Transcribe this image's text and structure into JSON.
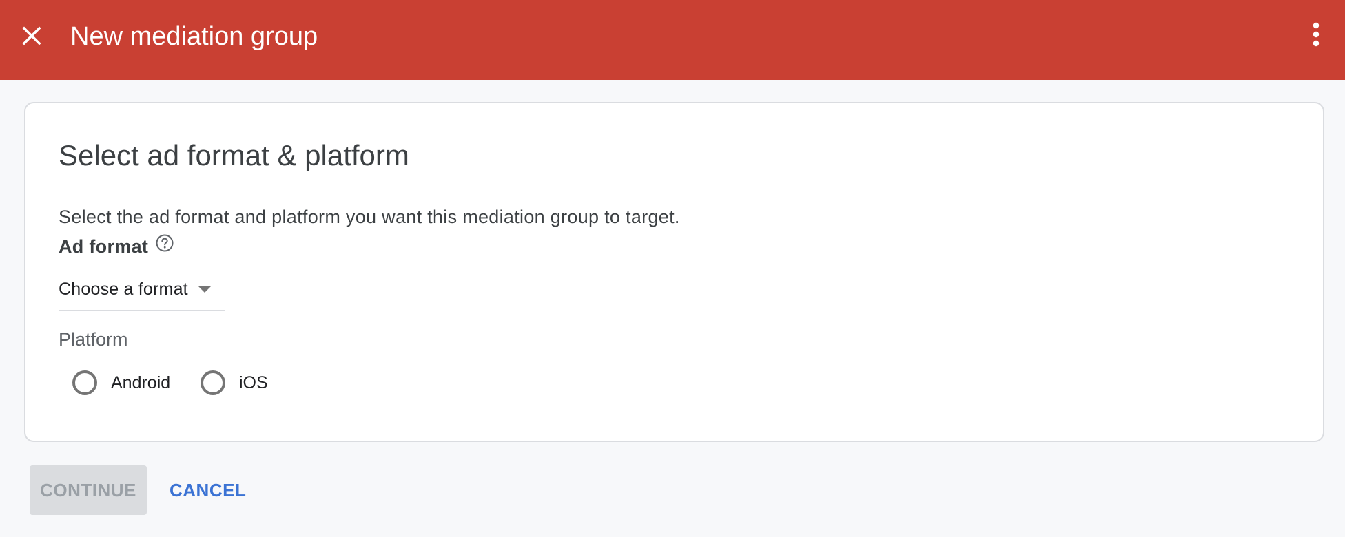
{
  "header": {
    "title": "New mediation group",
    "close_icon": "close-icon",
    "more_icon": "more-vert-icon",
    "background_color": "#c94033"
  },
  "card": {
    "title": "Select ad format & platform",
    "description": "Select the ad format and platform you want this mediation group to target.",
    "ad_format": {
      "label": "Ad format",
      "help_icon": "help-circle-icon",
      "selected_value": "Choose a format"
    },
    "platform": {
      "label": "Platform",
      "options": [
        {
          "label": "Android",
          "selected": false
        },
        {
          "label": "iOS",
          "selected": false
        }
      ]
    }
  },
  "actions": {
    "continue_label": "CONTINUE",
    "continue_enabled": false,
    "cancel_label": "CANCEL",
    "accent_color": "#3b73d4"
  }
}
